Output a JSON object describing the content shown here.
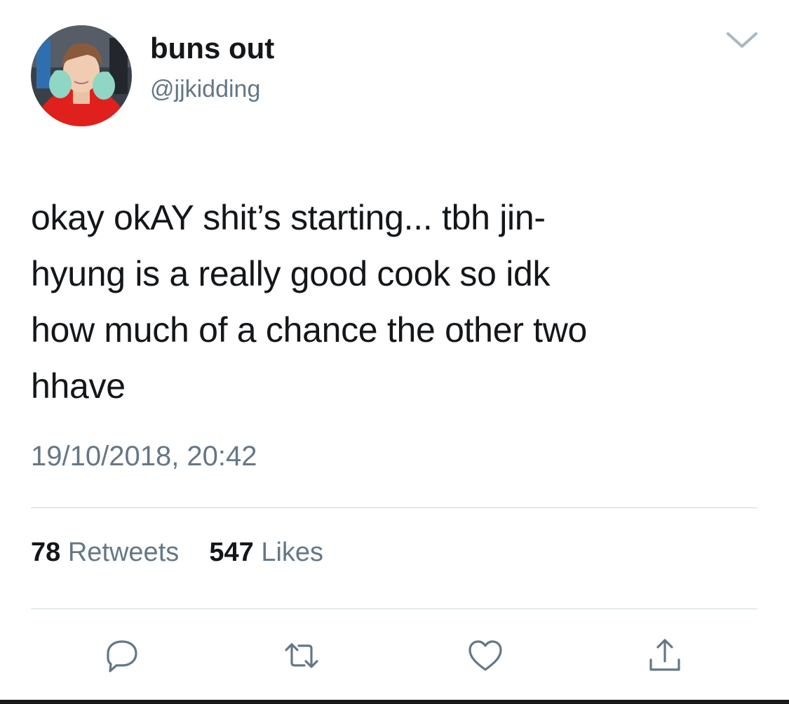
{
  "tweet": {
    "author": {
      "display_name": "buns out",
      "handle": "@jjkidding",
      "avatar_icon": "profile-photo"
    },
    "text": "okay okAY shit’s starting... tbh jin-\nhyung is a really good cook so idk\nhow much of a chance the other two\nhhave",
    "timestamp": "19/10/2018, 20:42",
    "stats": {
      "retweets_count": "78",
      "retweets_label": "Retweets",
      "likes_count": "547",
      "likes_label": "Likes"
    },
    "actions": [
      "reply-icon",
      "retweet-icon",
      "like-icon",
      "share-icon"
    ]
  },
  "colors": {
    "text_primary": "#14171a",
    "text_secondary": "#657786",
    "divider": "#ccd6dd",
    "icon": "#657786"
  }
}
